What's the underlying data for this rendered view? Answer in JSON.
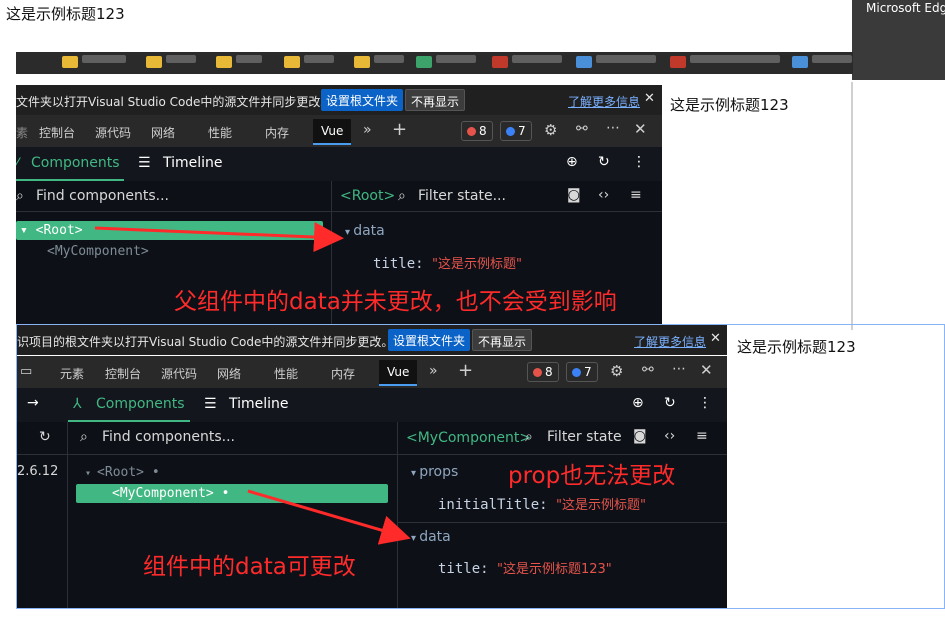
{
  "page": {
    "title": "这是示例标题123"
  },
  "edge_tooltip": "Microsoft Edge",
  "shot1": {
    "info_message": "文件夹以打开Visual Studio Code中的源文件并同步更改。",
    "set_root_label": "设置根文件夹",
    "dont_show_label": "不再显示",
    "learn_more_label": "了解更多信息",
    "tabs": [
      "控制台",
      "源代码",
      "网络",
      "性能",
      "内存",
      "Vue"
    ],
    "error_count": "8",
    "issue_count": "7",
    "nav_components": "Components",
    "nav_timeline": "Timeline",
    "find_placeholder": "Find components...",
    "root_node": "<Root>",
    "child_node": "<MyComponent>",
    "inspected": "<Root>",
    "filter_placeholder": "Filter state...",
    "data_label": "data",
    "title_key": "title",
    "title_value": "\"这是示例标题\"",
    "annotation": "父组件中的data并未更改，也不会受到影响",
    "side_title": "这是示例标题123"
  },
  "shot2": {
    "info_message": "识项目的根文件夹以打开Visual Studio Code中的源文件并同步更改。",
    "set_root_label": "设置根文件夹",
    "dont_show_label": "不再显示",
    "learn_more_label": "了解更多信息",
    "tabs": [
      "元素",
      "控制台",
      "源代码",
      "网络",
      "性能",
      "内存",
      "Vue"
    ],
    "error_count": "8",
    "issue_count": "7",
    "nav_components": "Components",
    "nav_timeline": "Timeline",
    "version": "2.6.12",
    "find_placeholder": "Find components...",
    "root_node": "<Root>",
    "child_node": "<MyComponent>",
    "inspected": "<MyComponent>",
    "filter_placeholder": "Filter state",
    "props_label": "props",
    "initial_title_key": "initialTitle",
    "initial_title_value": "\"这是示例标题\"",
    "data_label": "data",
    "title_key": "title",
    "title_value": "\"这是示例标题123\"",
    "annotation_props": "prop也无法更改",
    "annotation_data": "组件中的data可更改",
    "side_title": "这是示例标题123"
  },
  "colors": {
    "vue_green": "#41b883",
    "annotation_red": "#ff2a2a",
    "edge_blue": "#0c63c7"
  }
}
